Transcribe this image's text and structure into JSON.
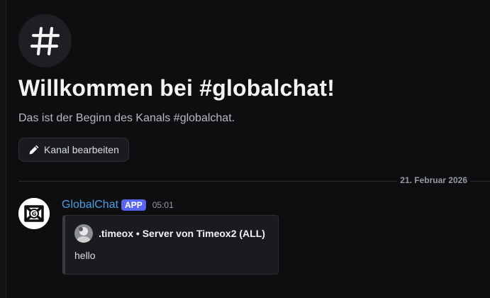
{
  "channel": {
    "icon": "hashtag-icon",
    "welcome_title": "Willkommen bei #globalchat!",
    "welcome_subtitle": "Das ist der Beginn des Kanals #globalchat.",
    "edit_button_label": "Kanal bearbeiten",
    "edit_button_icon": "pencil-icon"
  },
  "divider": {
    "date": "21. Februar 2026"
  },
  "message": {
    "username": "GlobalChat",
    "badge": "APP",
    "timestamp": "05:01",
    "avatar_icon": "globalchat-logo-icon",
    "embed": {
      "author": ".timeox • Server von Timeox2 (ALL)",
      "author_avatar_icon": "user-avatar-icon",
      "description": "hello"
    }
  },
  "colors": {
    "background": "#0e0e10",
    "username": "#4a9fe0",
    "badge": "#5865f2",
    "muted": "#949ba4"
  }
}
